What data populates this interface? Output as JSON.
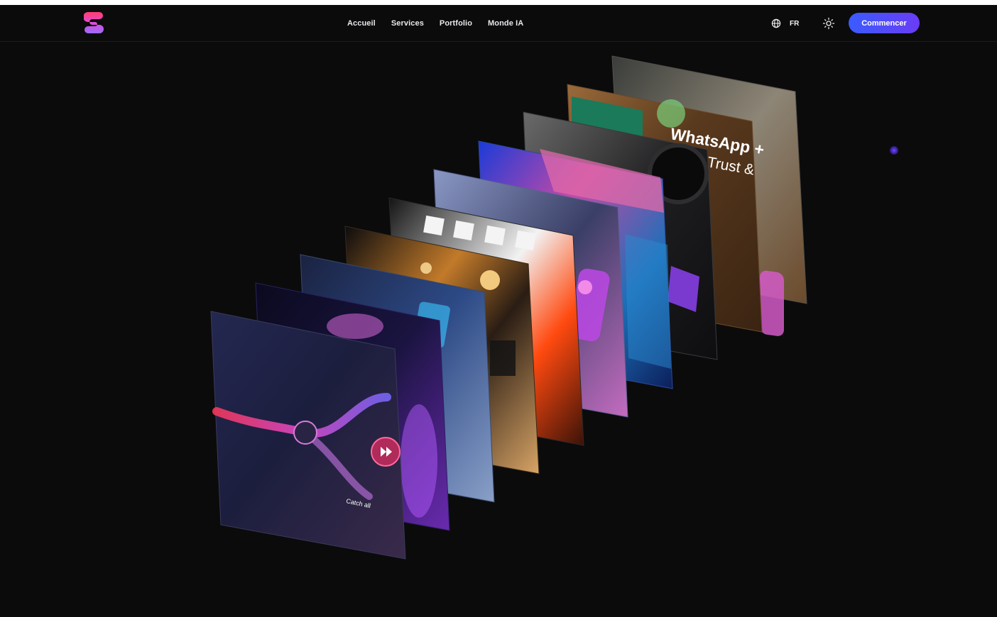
{
  "nav": {
    "links": [
      "Accueil",
      "Services",
      "Portfolio",
      "Monde IA"
    ],
    "language": "FR",
    "cta_label": "Commencer"
  },
  "icons": {
    "logo": "brand-s-logo",
    "language": "globe-icon",
    "theme": "sun-icon"
  },
  "colors": {
    "background": "#0b0b0c",
    "accent_start": "#3b5bff",
    "accent_end": "#6a3cf5"
  },
  "gallery": {
    "cards": [
      {
        "name": "card-office-desk",
        "caption": ""
      },
      {
        "name": "card-whatsapp-trust",
        "caption": "WhatsApp +\nTrust &"
      },
      {
        "name": "card-camera-lens",
        "caption": ""
      },
      {
        "name": "card-neon-city",
        "caption": ""
      },
      {
        "name": "card-purple-app-icon",
        "caption": ""
      },
      {
        "name": "card-film-strip",
        "caption": ""
      },
      {
        "name": "card-film-set",
        "caption": ""
      },
      {
        "name": "card-glass-device",
        "caption": ""
      },
      {
        "name": "card-particle-head",
        "caption": ""
      },
      {
        "name": "card-ai-workflow",
        "caption": "Catch all"
      }
    ]
  }
}
